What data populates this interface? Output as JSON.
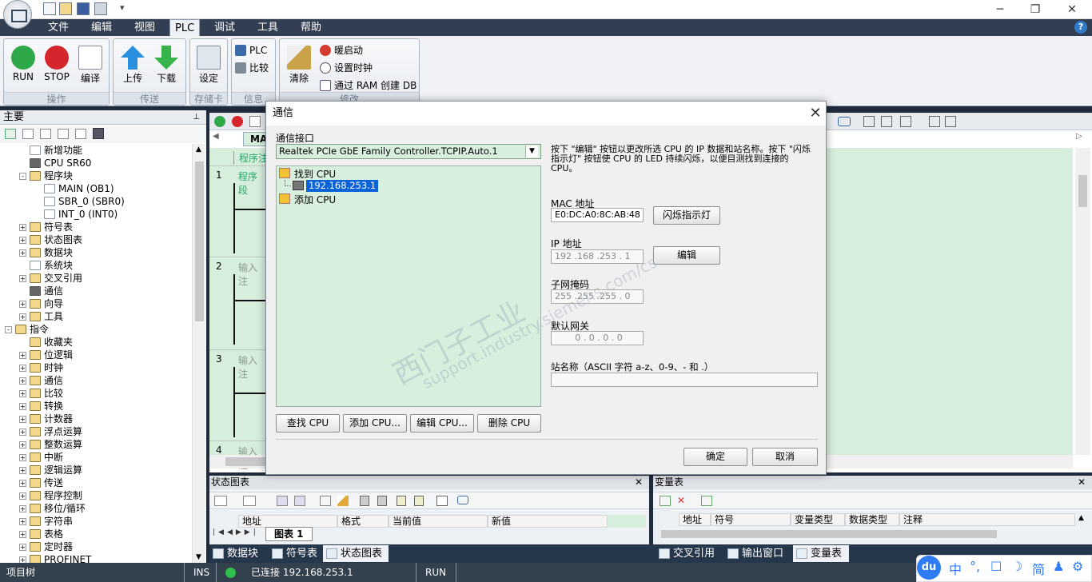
{
  "window": {
    "minimize": "─",
    "maximize": "❐",
    "close": "✕"
  },
  "menu": {
    "items": [
      "文件",
      "编辑",
      "视图",
      "PLC",
      "调试",
      "工具",
      "帮助"
    ],
    "help": "?"
  },
  "ribbon": {
    "groups": {
      "operate": "操作",
      "transfer": "传送",
      "memcard": "存储卡",
      "info": "信息",
      "modify": "修改"
    },
    "run": "RUN",
    "stop": "STOP",
    "compile": "编译",
    "upload": "上传",
    "download": "下载",
    "settings": "设定",
    "plc": "PLC",
    "compare": "比较",
    "clear": "清除",
    "warm_start": "暖启动",
    "set_clock": "设置时钟",
    "create_db": "通过 RAM 创建 DB"
  },
  "leftpanel": {
    "title": "主要",
    "pin": "⊥",
    "tree": [
      {
        "label": "新增功能",
        "indent": 2,
        "icon": "doc",
        "expand": ""
      },
      {
        "label": "CPU SR60",
        "indent": 2,
        "icon": "cpu",
        "expand": ""
      },
      {
        "label": "程序块",
        "indent": 2,
        "icon": "folder",
        "expand": "-"
      },
      {
        "label": "MAIN (OB1)",
        "indent": 3,
        "icon": "doc",
        "expand": ""
      },
      {
        "label": "SBR_0 (SBR0)",
        "indent": 3,
        "icon": "doc",
        "expand": ""
      },
      {
        "label": "INT_0 (INT0)",
        "indent": 3,
        "icon": "doc",
        "expand": ""
      },
      {
        "label": "符号表",
        "indent": 2,
        "icon": "folder",
        "expand": "+"
      },
      {
        "label": "状态图表",
        "indent": 2,
        "icon": "folder",
        "expand": "+"
      },
      {
        "label": "数据块",
        "indent": 2,
        "icon": "folder",
        "expand": "+"
      },
      {
        "label": "系统块",
        "indent": 2,
        "icon": "doc",
        "expand": ""
      },
      {
        "label": "交叉引用",
        "indent": 2,
        "icon": "folder",
        "expand": "+"
      },
      {
        "label": "通信",
        "indent": 2,
        "icon": "cpu",
        "expand": ""
      },
      {
        "label": "向导",
        "indent": 2,
        "icon": "folder",
        "expand": "+"
      },
      {
        "label": "工具",
        "indent": 2,
        "icon": "folder",
        "expand": "+"
      },
      {
        "label": "指令",
        "indent": 1,
        "icon": "folder",
        "expand": "-"
      },
      {
        "label": "收藏夹",
        "indent": 2,
        "icon": "folder",
        "expand": ""
      },
      {
        "label": "位逻辑",
        "indent": 2,
        "icon": "folder",
        "expand": "+"
      },
      {
        "label": "时钟",
        "indent": 2,
        "icon": "folder",
        "expand": "+"
      },
      {
        "label": "通信",
        "indent": 2,
        "icon": "folder",
        "expand": "+"
      },
      {
        "label": "比较",
        "indent": 2,
        "icon": "folder",
        "expand": "+"
      },
      {
        "label": "转换",
        "indent": 2,
        "icon": "folder",
        "expand": "+"
      },
      {
        "label": "计数器",
        "indent": 2,
        "icon": "folder",
        "expand": "+"
      },
      {
        "label": "浮点运算",
        "indent": 2,
        "icon": "folder",
        "expand": "+"
      },
      {
        "label": "整数运算",
        "indent": 2,
        "icon": "folder",
        "expand": "+"
      },
      {
        "label": "中断",
        "indent": 2,
        "icon": "folder",
        "expand": "+"
      },
      {
        "label": "逻辑运算",
        "indent": 2,
        "icon": "folder",
        "expand": "+"
      },
      {
        "label": "传送",
        "indent": 2,
        "icon": "folder",
        "expand": "+"
      },
      {
        "label": "程序控制",
        "indent": 2,
        "icon": "folder",
        "expand": "+"
      },
      {
        "label": "移位/循环",
        "indent": 2,
        "icon": "folder",
        "expand": "+"
      },
      {
        "label": "字符串",
        "indent": 2,
        "icon": "folder",
        "expand": "+"
      },
      {
        "label": "表格",
        "indent": 2,
        "icon": "folder",
        "expand": "+"
      },
      {
        "label": "定时器",
        "indent": 2,
        "icon": "folder",
        "expand": "+"
      },
      {
        "label": "PROFINET",
        "indent": 2,
        "icon": "folder",
        "expand": "+"
      }
    ]
  },
  "editor": {
    "tab": "MAI",
    "comment": "程序注",
    "networks": [
      {
        "num": "1",
        "comment": "程序段"
      },
      {
        "num": "2",
        "comment": "输入注"
      },
      {
        "num": "3",
        "comment": "输入注"
      },
      {
        "num": "4",
        "comment": "输入注"
      }
    ]
  },
  "statuspane": {
    "title": "状态图表",
    "columns": [
      "地址",
      "格式",
      "当前值",
      "新值"
    ],
    "tab": "图表 1"
  },
  "varpane": {
    "title": "变量表",
    "columns": [
      "地址",
      "符号",
      "变量类型",
      "数据类型",
      "注释"
    ]
  },
  "bottomtabs": [
    "数据块",
    "符号表",
    "状态图表",
    "交叉引用",
    "输出窗口",
    "变量表"
  ],
  "statusbar": {
    "tree": "项目树",
    "ins": "INS",
    "connection": "已连接 192.168.253.1",
    "mode": "RUN"
  },
  "dialog": {
    "title": "通信",
    "interface_label": "通信接口",
    "interface_value": "Realtek PCIe GbE Family Controller.TCPIP.Auto.1",
    "tree": {
      "found": "找到 CPU",
      "ip_item": "192.168.253.1",
      "add": "添加 CPU"
    },
    "info": "按下 \"编辑\" 按钮以更改所选 CPU 的 IP 数据和站名称。按下 \"闪烁指示灯\" 按钮使 CPU 的 LED 持续闪烁，以便目测找到连接的 CPU。",
    "mac_label": "MAC 地址",
    "mac_value": "E0:DC:A0:8C:AB:48",
    "blink_button": "闪烁指示灯",
    "ip_label": "IP 地址",
    "ip_value": "192 .168 .253 . 1",
    "edit_button": "编辑",
    "subnet_label": "子网掩码",
    "subnet_value": "255 .255 .255 . 0",
    "gateway_label": "默认网关",
    "gateway_value": "0 . 0 . 0 . 0",
    "station_label": "站名称（ASCII 字符 a-z、0-9、- 和 .）",
    "station_value": "",
    "find_button": "查找 CPU",
    "add_button": "添加 CPU...",
    "editcpu_button": "编辑 CPU...",
    "delete_button": "删除 CPU",
    "ok_button": "确定",
    "cancel_button": "取消"
  },
  "watermark": {
    "line1": "西门子工业",
    "line2": "support.industry.siemens.com/cs"
  },
  "ime": {
    "logo": "du",
    "keys": [
      "中",
      "°,",
      "☐",
      "☽",
      "简",
      "♟",
      "⚙"
    ]
  }
}
